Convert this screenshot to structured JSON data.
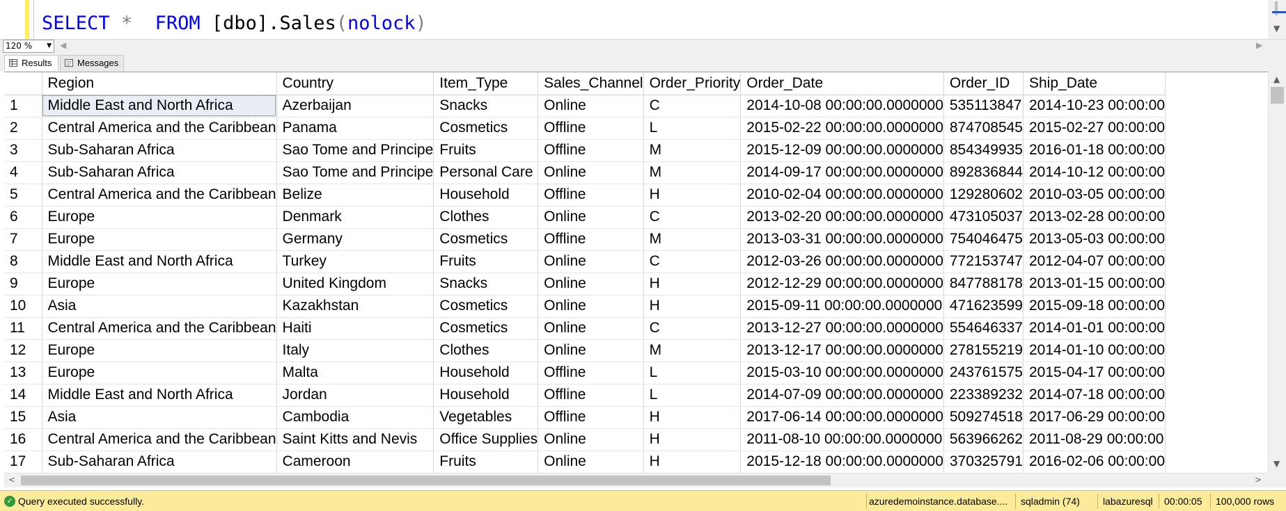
{
  "editor": {
    "kw_select": "SELECT",
    "star": "*",
    "kw_from": "FROM",
    "table_ref": "[dbo].Sales",
    "paren_open": "(",
    "hint": "nolock",
    "paren_close": ")"
  },
  "zoom": {
    "value": "120 %"
  },
  "tabs": {
    "results": "Results",
    "messages": "Messages"
  },
  "grid": {
    "columns": [
      "Region",
      "Country",
      "Item_Type",
      "Sales_Channel",
      "Order_Priority",
      "Order_Date",
      "Order_ID",
      "Ship_Date"
    ],
    "rows": [
      [
        "1",
        "Middle East and North Africa",
        "Azerbaijan",
        "Snacks",
        "Online",
        "C",
        "2014-10-08 00:00:00.0000000",
        "535113847",
        "2014-10-23 00:00:00"
      ],
      [
        "2",
        "Central America and the Caribbean",
        "Panama",
        "Cosmetics",
        "Offline",
        "L",
        "2015-02-22 00:00:00.0000000",
        "874708545",
        "2015-02-27 00:00:00"
      ],
      [
        "3",
        "Sub-Saharan Africa",
        "Sao Tome and Principe",
        "Fruits",
        "Offline",
        "M",
        "2015-12-09 00:00:00.0000000",
        "854349935",
        "2016-01-18 00:00:00"
      ],
      [
        "4",
        "Sub-Saharan Africa",
        "Sao Tome and Principe",
        "Personal Care",
        "Online",
        "M",
        "2014-09-17 00:00:00.0000000",
        "892836844",
        "2014-10-12 00:00:00"
      ],
      [
        "5",
        "Central America and the Caribbean",
        "Belize",
        "Household",
        "Offline",
        "H",
        "2010-02-04 00:00:00.0000000",
        "129280602",
        "2010-03-05 00:00:00"
      ],
      [
        "6",
        "Europe",
        "Denmark",
        "Clothes",
        "Online",
        "C",
        "2013-02-20 00:00:00.0000000",
        "473105037",
        "2013-02-28 00:00:00"
      ],
      [
        "7",
        "Europe",
        "Germany",
        "Cosmetics",
        "Offline",
        "M",
        "2013-03-31 00:00:00.0000000",
        "754046475",
        "2013-05-03 00:00:00"
      ],
      [
        "8",
        "Middle East and North Africa",
        "Turkey",
        "Fruits",
        "Online",
        "C",
        "2012-03-26 00:00:00.0000000",
        "772153747",
        "2012-04-07 00:00:00"
      ],
      [
        "9",
        "Europe",
        "United Kingdom",
        "Snacks",
        "Online",
        "H",
        "2012-12-29 00:00:00.0000000",
        "847788178",
        "2013-01-15 00:00:00"
      ],
      [
        "10",
        "Asia",
        "Kazakhstan",
        "Cosmetics",
        "Online",
        "H",
        "2015-09-11 00:00:00.0000000",
        "471623599",
        "2015-09-18 00:00:00"
      ],
      [
        "11",
        "Central America and the Caribbean",
        "Haiti",
        "Cosmetics",
        "Online",
        "C",
        "2013-12-27 00:00:00.0000000",
        "554646337",
        "2014-01-01 00:00:00"
      ],
      [
        "12",
        "Europe",
        "Italy",
        "Clothes",
        "Online",
        "M",
        "2013-12-17 00:00:00.0000000",
        "278155219",
        "2014-01-10 00:00:00"
      ],
      [
        "13",
        "Europe",
        "Malta",
        "Household",
        "Offline",
        "L",
        "2015-03-10 00:00:00.0000000",
        "243761575",
        "2015-04-17 00:00:00"
      ],
      [
        "14",
        "Middle East and North Africa",
        "Jordan",
        "Household",
        "Offline",
        "L",
        "2014-07-09 00:00:00.0000000",
        "223389232",
        "2014-07-18 00:00:00"
      ],
      [
        "15",
        "Asia",
        "Cambodia",
        "Vegetables",
        "Offline",
        "H",
        "2017-06-14 00:00:00.0000000",
        "509274518",
        "2017-06-29 00:00:00"
      ],
      [
        "16",
        "Central America and the Caribbean",
        "Saint Kitts and Nevis",
        "Office Supplies",
        "Online",
        "H",
        "2011-08-10 00:00:00.0000000",
        "563966262",
        "2011-08-29 00:00:00"
      ],
      [
        "17",
        "Sub-Saharan Africa",
        "Cameroon",
        "Fruits",
        "Online",
        "H",
        "2015-12-18 00:00:00.0000000",
        "370325791",
        "2016-02-06 00:00:00"
      ]
    ]
  },
  "status": {
    "message": "Query executed successfully.",
    "server": "azuredemoinstance.database....",
    "user": "sqladmin (74)",
    "database": "labazuresql",
    "elapsed": "00:00:05",
    "rows": "100,000 rows"
  },
  "colors": {
    "keyword": "#0000ff",
    "function": "#ff00ff",
    "status_bg": "#fbeb9a",
    "success_icon": "#2f9a36"
  }
}
